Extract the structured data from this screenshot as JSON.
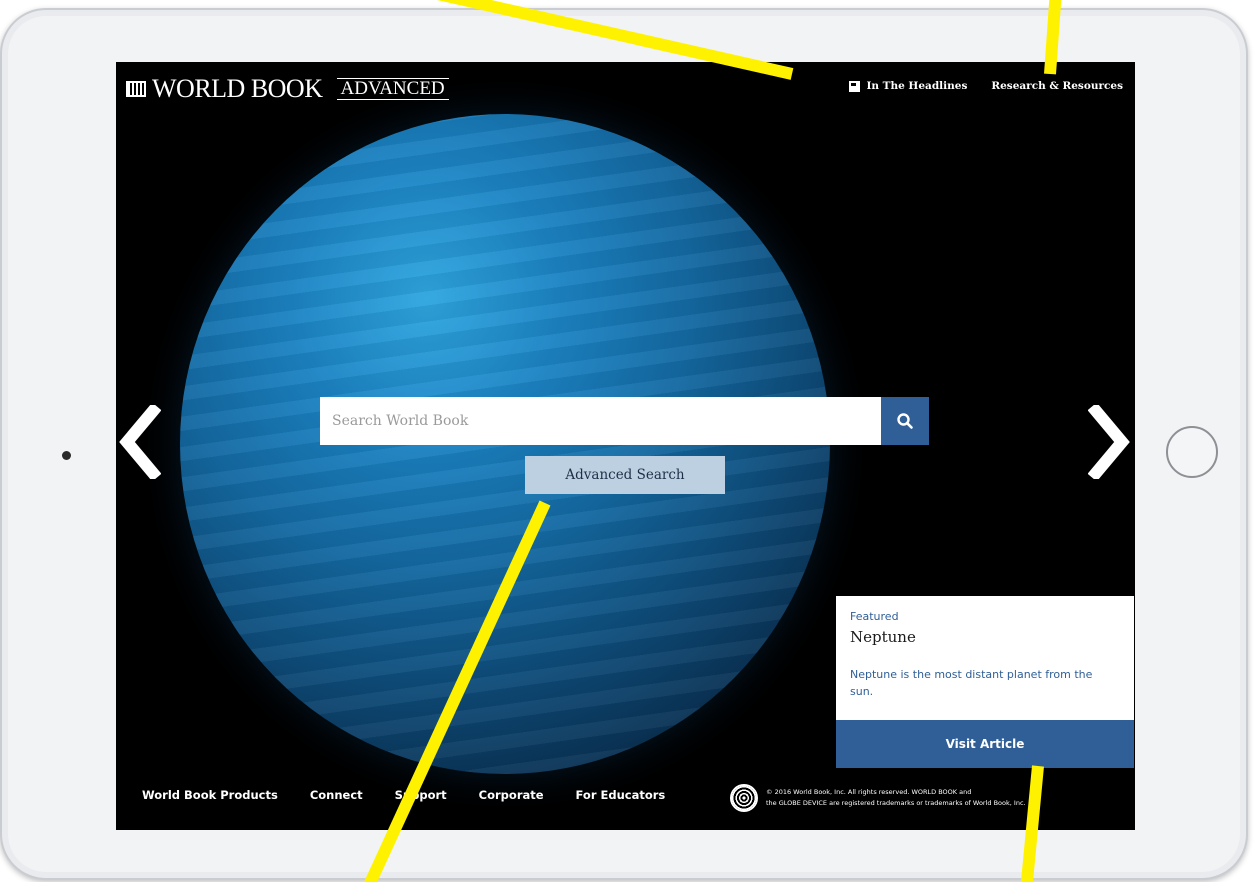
{
  "device": {
    "home_button": "home-button",
    "camera": "front-camera"
  },
  "header": {
    "brand_name": "WORLD BOOK",
    "brand_edition": "ADVANCED",
    "nav": [
      {
        "label": "In The Headlines",
        "icon": "newspaper-icon"
      },
      {
        "label": "Research & Resources"
      }
    ]
  },
  "search": {
    "placeholder": "Search World Book",
    "button_icon": "search-icon",
    "advanced_label": "Advanced Search"
  },
  "carousel": {
    "prev_icon": "chevron-left-icon",
    "next_icon": "chevron-right-icon"
  },
  "featured": {
    "kicker": "Featured",
    "title": "Neptune",
    "description": "Neptune is the most distant planet from the sun.",
    "button_label": "Visit Article"
  },
  "footer": {
    "links": [
      "World Book Products",
      "Connect",
      "Support",
      "Corporate",
      "For Educators"
    ],
    "copyright_line1": "© 2016 World Book, Inc. All rights reserved. WORLD BOOK and",
    "copyright_line2": "the GLOBE DEVICE are registered trademarks or trademarks of World Book, Inc."
  },
  "colors": {
    "accent": "#2f5f96",
    "advanced_button": "#bcd0e2",
    "annotation": "#fff200"
  }
}
